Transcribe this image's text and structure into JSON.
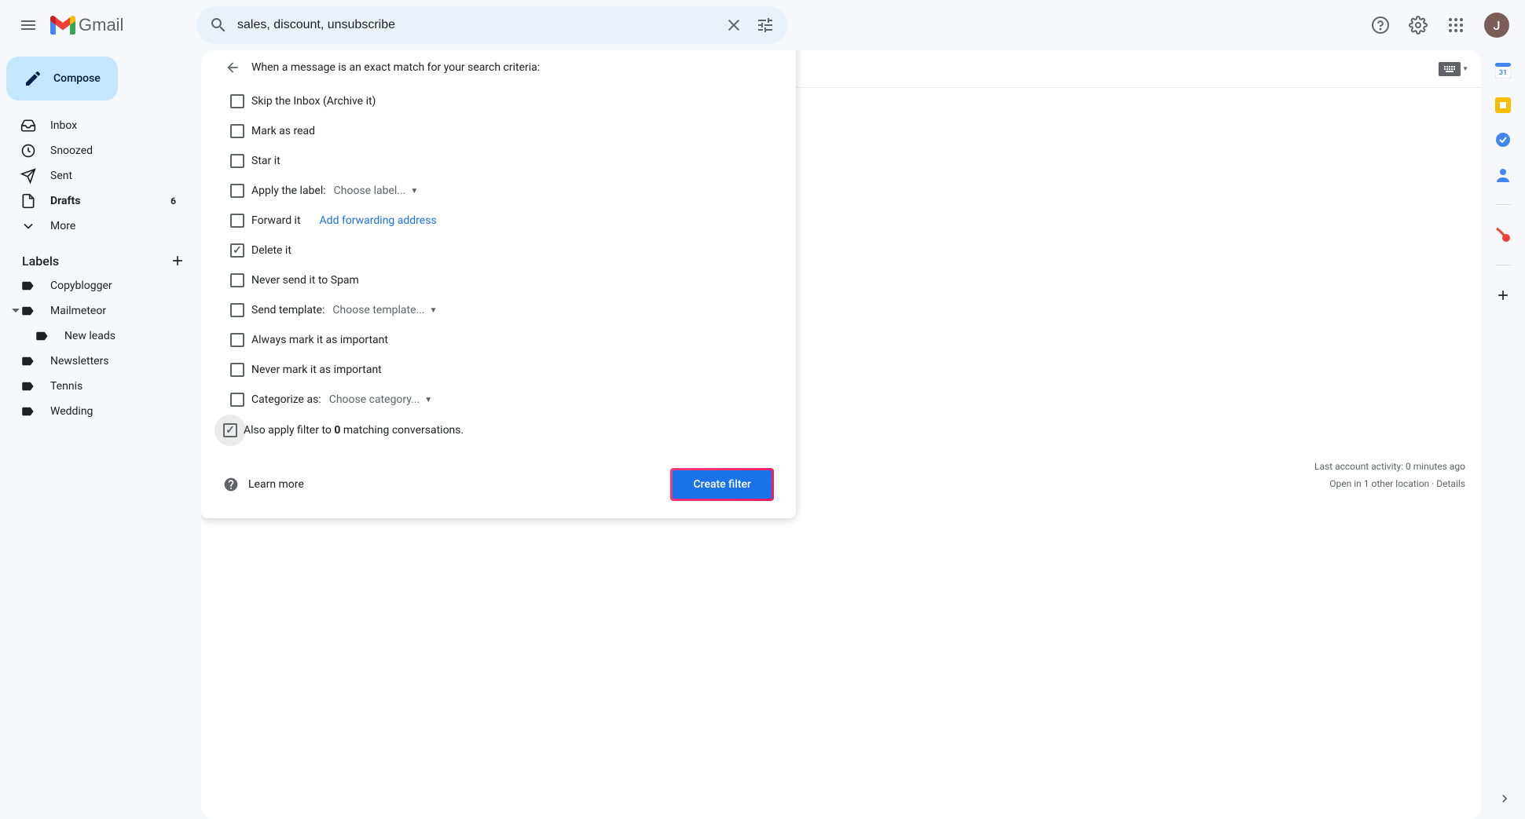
{
  "header": {
    "brand": "Gmail",
    "search_value": "sales, discount, unsubscribe",
    "avatar_initial": "J"
  },
  "sidebar": {
    "compose_label": "Compose",
    "items": [
      {
        "label": "Inbox",
        "count": ""
      },
      {
        "label": "Snoozed",
        "count": ""
      },
      {
        "label": "Sent",
        "count": ""
      },
      {
        "label": "Drafts",
        "count": "6"
      },
      {
        "label": "More",
        "count": ""
      }
    ],
    "labels_header": "Labels",
    "labels": [
      {
        "name": "Copyblogger"
      },
      {
        "name": "Mailmeteor"
      },
      {
        "name": "New leads"
      },
      {
        "name": "Newsletters"
      },
      {
        "name": "Tennis"
      },
      {
        "name": "Wedding"
      }
    ]
  },
  "filter_panel": {
    "header_text": "When a message is an exact match for your search criteria:",
    "opt_skip_inbox": "Skip the Inbox (Archive it)",
    "opt_mark_read": "Mark as read",
    "opt_star": "Star it",
    "opt_apply_label": "Apply the label:",
    "dropdown_choose_label": "Choose label...",
    "opt_forward": "Forward it",
    "link_add_forwarding": "Add forwarding address",
    "opt_delete": "Delete it",
    "opt_never_spam": "Never send it to Spam",
    "opt_send_template": "Send template:",
    "dropdown_choose_template": "Choose template...",
    "opt_always_important": "Always mark it as important",
    "opt_never_important": "Never mark it as important",
    "opt_categorize": "Categorize as:",
    "dropdown_choose_category": "Choose category...",
    "opt_also_apply_pre": "Also apply filter to ",
    "match_count": "0",
    "opt_also_apply_post": " matching conversations.",
    "learn_more": "Learn more",
    "create_filter_btn": "Create filter"
  },
  "footer": {
    "activity": "Last account activity: 0 minutes ago",
    "location": "Open in 1 other location",
    "details": "Details"
  }
}
